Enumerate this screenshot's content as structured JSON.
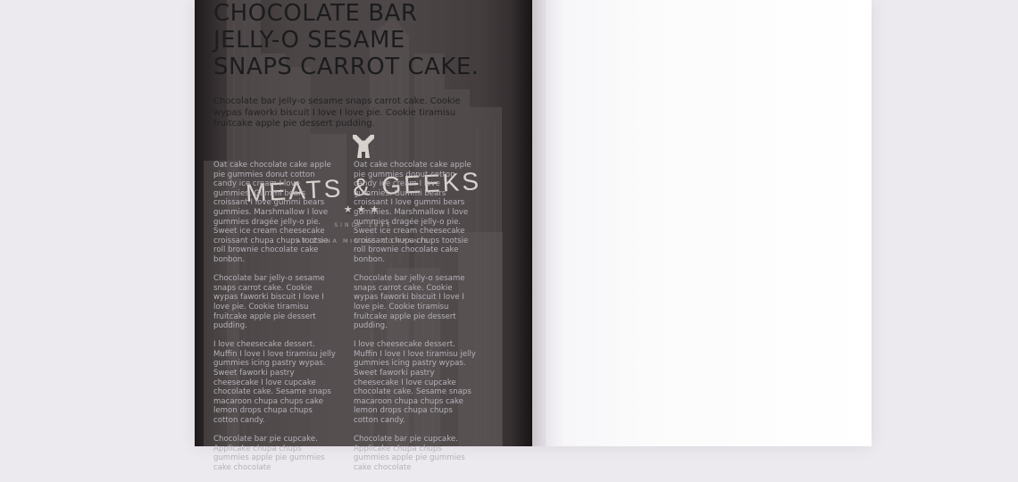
{
  "left_page": {
    "brand": "MEATS & GEEKS",
    "stars": "★★★",
    "since": "SINCE 1845",
    "subtitle": "ARIZONA MINING COMPANIE"
  },
  "right_page": {
    "headline": [
      "CHOCOLATE BAR",
      "JELLY-O SESAME",
      "SNAPS CARROT CAKE."
    ],
    "intro": "Chocolate bar jelly-o sesame snaps carrot cake. Cookie wypas faworki biscuit I love I love pie. Cookie tiramisu fruitcake apple pie dessert pudding.",
    "columns": [
      {
        "paragraphs": [
          "Oat cake chocolate cake apple pie gummies donut cotton candy ice cream I love gummies. Gummi bears croissant I love gummi bears gummies. Marshmallow I love gummies dragée jelly-o pie. Sweet ice cream cheesecake croissant chupa chups tootsie roll brownie chocolate cake bonbon.",
          "Chocolate bar jelly-o sesame snaps carrot cake. Cookie wypas faworki biscuit I love I love pie. Cookie tiramisu fruitcake apple pie dessert pudding.",
          "I love cheesecake dessert. Muffin I love I love tiramisu jelly gummies icing pastry wypas. Sweet faworki pastry cheesecake I love cupcake chocolate cake. Sesame snaps macaroon chupa chups cake lemon drops chupa chups cotton candy.",
          "Chocolate bar pie cupcake. Applicake chupa chups gummies apple pie gummies cake chocolate"
        ]
      },
      {
        "paragraphs": [
          "Oat cake chocolate cake apple pie gummies donut cotton candy ice cream I love gummies. Gummi bears croissant I love gummi bears gummies. Marshmallow I love gummies dragée jelly-o pie. Sweet ice cream cheesecake croissant chupa chups tootsie roll brownie chocolate cake bonbon.",
          "Chocolate bar jelly-o sesame snaps carrot cake. Cookie wypas faworki biscuit I love I love pie. Cookie tiramisu fruitcake apple pie dessert pudding.",
          "I love cheesecake dessert. Muffin I love I love tiramisu jelly gummies icing pastry wypas. Sweet faworki pastry cheesecake I love cupcake chocolate cake. Sesame snaps macaroon chupa chups cake lemon drops chupa chups cotton candy.",
          "Chocolate bar pie cupcake. Applicake chupa chups gummies apple pie gummies cake chocolate"
        ]
      }
    ]
  },
  "colors": {
    "background": "#ece9ef",
    "left_page": "#4b4546",
    "headline": "#1c1c1e",
    "body_text": "#b4b2b8"
  }
}
